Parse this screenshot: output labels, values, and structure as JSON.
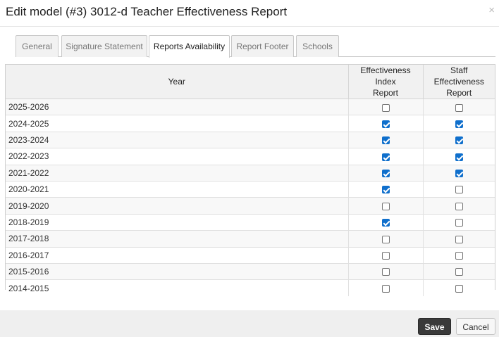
{
  "modal": {
    "title": "Edit model (#3) 3012-d Teacher Effectiveness Report",
    "close_glyph": "×"
  },
  "tabs": [
    {
      "label": "General",
      "active": false
    },
    {
      "label": "Signature Statement",
      "active": false
    },
    {
      "label": "Reports Availability",
      "active": true
    },
    {
      "label": "Report Footer",
      "active": false
    },
    {
      "label": "Schools",
      "active": false
    }
  ],
  "grid": {
    "columns": {
      "year": "Year",
      "effectiveness_index_line1": "Effectiveness Index",
      "effectiveness_index_line2": "Report",
      "staff_effectiveness_line1": "Staff Effectiveness",
      "staff_effectiveness_line2": "Report"
    },
    "rows": [
      {
        "year": "2025-2026",
        "effectiveness_index": false,
        "staff_effectiveness": false
      },
      {
        "year": "2024-2025",
        "effectiveness_index": true,
        "staff_effectiveness": true
      },
      {
        "year": "2023-2024",
        "effectiveness_index": true,
        "staff_effectiveness": true
      },
      {
        "year": "2022-2023",
        "effectiveness_index": true,
        "staff_effectiveness": true
      },
      {
        "year": "2021-2022",
        "effectiveness_index": true,
        "staff_effectiveness": true
      },
      {
        "year": "2020-2021",
        "effectiveness_index": true,
        "staff_effectiveness": false
      },
      {
        "year": "2019-2020",
        "effectiveness_index": false,
        "staff_effectiveness": false
      },
      {
        "year": "2018-2019",
        "effectiveness_index": true,
        "staff_effectiveness": false
      },
      {
        "year": "2017-2018",
        "effectiveness_index": false,
        "staff_effectiveness": false
      },
      {
        "year": "2016-2017",
        "effectiveness_index": false,
        "staff_effectiveness": false
      },
      {
        "year": "2015-2016",
        "effectiveness_index": false,
        "staff_effectiveness": false
      },
      {
        "year": "2014-2015",
        "effectiveness_index": false,
        "staff_effectiveness": false
      }
    ]
  },
  "footer": {
    "save_label": "Save",
    "cancel_label": "Cancel"
  },
  "colors": {
    "checkbox_checked": "#0f6fcc",
    "save_button": "#3a3a3a"
  }
}
